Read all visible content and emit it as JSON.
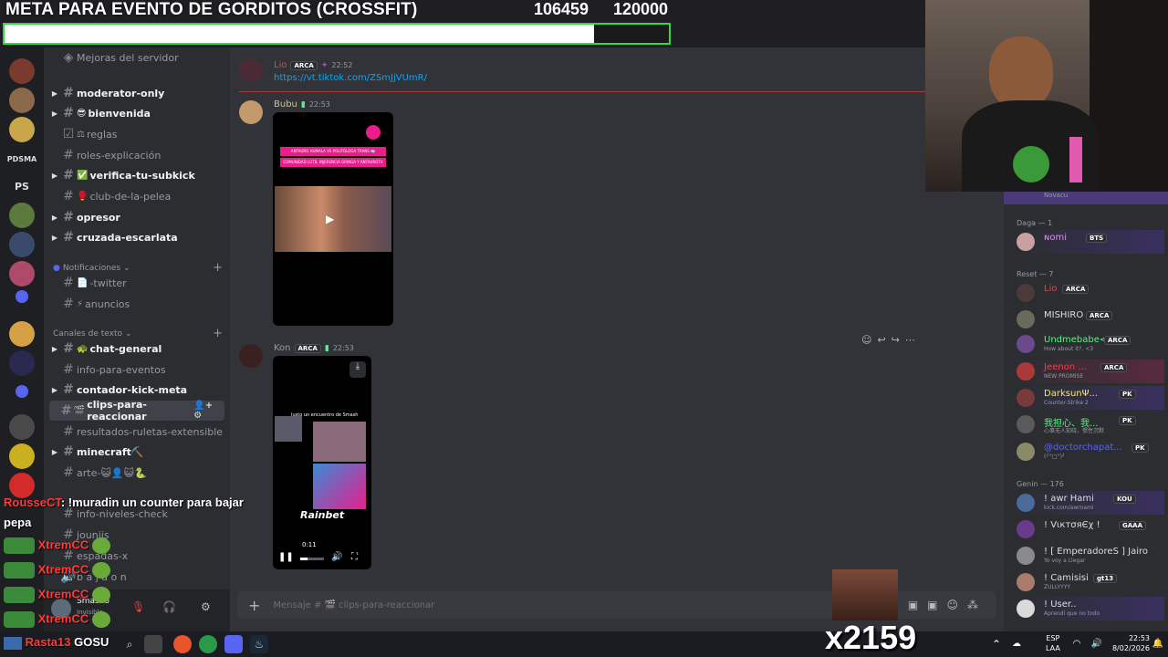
{
  "goal": {
    "title": "META PARA EVENTO DE GORDITOS (CROSSFIT)",
    "current": "106459",
    "target": "120000",
    "progress_fraction": 0.887
  },
  "rail": {
    "items": [
      "PDSMA",
      "PS"
    ]
  },
  "sidebar": {
    "server_boosts": "Mejoras del servidor",
    "notifications_category": "Notificaciones",
    "text_category": "Canales de texto",
    "channels": [
      {
        "name": "moderator-only",
        "emoji": "",
        "unread": true,
        "arrow": true
      },
      {
        "name": "bienvenida",
        "emoji": "😎",
        "unread": true,
        "arrow": true
      },
      {
        "name": "reglas",
        "emoji": "⚖",
        "unread": false,
        "arrow": false,
        "icon": "rules-icon"
      },
      {
        "name": "roles-explicación",
        "emoji": "",
        "unread": false,
        "arrow": false
      },
      {
        "name": "verifica-tu-subkick",
        "emoji": "✅",
        "unread": true,
        "arrow": true
      },
      {
        "name": "club-de-la-pelea",
        "emoji": "🥊",
        "unread": false,
        "arrow": false
      },
      {
        "name": "opresor",
        "emoji": "",
        "unread": true,
        "arrow": true
      },
      {
        "name": "cruzada-escarlata",
        "emoji": "",
        "unread": true,
        "arrow": true
      },
      {
        "name": "-twitter",
        "emoji": "📄",
        "unread": false,
        "arrow": false
      },
      {
        "name": "anuncios",
        "emoji": "⚡",
        "unread": false,
        "arrow": false
      },
      {
        "name": "chat-general",
        "emoji": "🐢",
        "unread": true,
        "arrow": true
      },
      {
        "name": "info-para-eventos",
        "emoji": "",
        "unread": false,
        "arrow": false
      },
      {
        "name": "contador-kick-meta",
        "emoji": "",
        "unread": true,
        "arrow": true
      },
      {
        "name": "clips-para-reaccionar",
        "emoji": "🎬",
        "unread": true,
        "arrow": true,
        "active": true
      },
      {
        "name": "resultados-ruletas-extensible",
        "emoji": "",
        "unread": false,
        "arrow": false
      },
      {
        "name": "minecraft⛏️",
        "emoji": "",
        "unread": true,
        "arrow": true
      },
      {
        "name": "arte-😺👤😺🐍",
        "emoji": "",
        "unread": false,
        "arrow": false
      },
      {
        "name": "info-niveles-check",
        "emoji": "",
        "unread": false,
        "arrow": false
      },
      {
        "name": "jouniis",
        "emoji": "",
        "unread": false,
        "arrow": false
      },
      {
        "name": "espadas-x",
        "emoji": "",
        "unread": false,
        "arrow": false
      }
    ],
    "user": {
      "name": "Smasho",
      "status": "Invisible"
    },
    "voice_label": "b a j a  o n"
  },
  "chat": {
    "messages": [
      {
        "author": "Lio",
        "badge": "ARCA",
        "time": "22:52",
        "link": "https://vt.tiktok.com/ZSmJjVUmR/"
      },
      {
        "author": "Bubu",
        "time": "22:53",
        "card_line1": "ANTAURO HUMALA VS POLITÓLOGA TRANS 🏳️‍⚧️",
        "card_line2": "COMUNIDAD LGTB, INJERENCIA GRINGA Y ANTAUROTV"
      },
      {
        "author": "Kon",
        "badge": "ARCA",
        "time": "22:53",
        "video_caption": "Justo un encuentro de Smash",
        "video_brand": "Rainbet",
        "video_time": "0:11"
      }
    ],
    "composer_placeholder": "Mensaje # 🎬 clips-para-reaccionar"
  },
  "members": {
    "top_label": "Novacu",
    "groups": [
      {
        "title": "Daga — 1",
        "members": [
          {
            "name": "ɴomi",
            "tag": "BTS",
            "color": "#f47fff"
          }
        ]
      },
      {
        "title": "Reset — 7",
        "members": [
          {
            "name": "Lio",
            "tag": "ARCA",
            "color": "#ed4245"
          },
          {
            "name": "MISHIRO",
            "tag": "ARCA",
            "color": "#dbdee1"
          },
          {
            "name": "Undmebabe<3",
            "tag": "ARCA",
            "color": "#57f287",
            "status": "How about it?, <3"
          },
          {
            "name": "Jeenon ...",
            "tag": "ARCA",
            "color": "#ed4245",
            "status": "NEW PROMISE"
          },
          {
            "name": "DarksunΨ...",
            "tag": "PK",
            "color": "#fee75c",
            "status": "Counter-Strike 2"
          },
          {
            "name": "我担心、我...",
            "tag": "PK",
            "color": "#57f287",
            "status": "心事无人知晓，惯性沉默"
          },
          {
            "name": "@doctorchapat...",
            "tag": "PK",
            "color": "#5865f2",
            "status": "(╯°□°)╯"
          }
        ]
      },
      {
        "title": "Genin — 176",
        "members": [
          {
            "name": "! awr Hami",
            "tag": "KOU",
            "color": "#dbdee1",
            "status": "kick.com/awrnami"
          },
          {
            "name": "! VιктσяЄχ !",
            "tag": "GAAA",
            "color": "#dbdee1"
          },
          {
            "name": "! [ EmperadoreS ] Jairo",
            "tag": "",
            "color": "#dbdee1",
            "status": "Yo voy a Llegar"
          },
          {
            "name": "! Camisisi",
            "tag": "gt13",
            "color": "#dbdee1",
            "status": "ZULLYYYY"
          },
          {
            "name": "! User..",
            "tag": "",
            "color": "#dbdee1",
            "status": "Aprendí que no todo"
          }
        ]
      }
    ]
  },
  "overlay_chat": [
    {
      "user": "RousseCT",
      "text": ": !muradin un counter para bajar pepa",
      "color": "#ff3b3b"
    },
    {
      "user": "XtremCC",
      "text": "",
      "color": "#ff3b3b"
    },
    {
      "user": "XtremCC",
      "text": "",
      "color": "#ff3b3b"
    },
    {
      "user": "XtremCC",
      "text": "",
      "color": "#ff3b3b"
    },
    {
      "user": "XtremCC",
      "text": "",
      "color": "#ff3b3b"
    },
    {
      "user": "Rasta13",
      "text": "GOSU",
      "color": "#ff3b3b"
    }
  ],
  "overlay_counter": "x2159",
  "taskbar": {
    "lang": "ESP",
    "lang_sub": "LAA",
    "time": "22:53",
    "date": "8/02/2026"
  }
}
